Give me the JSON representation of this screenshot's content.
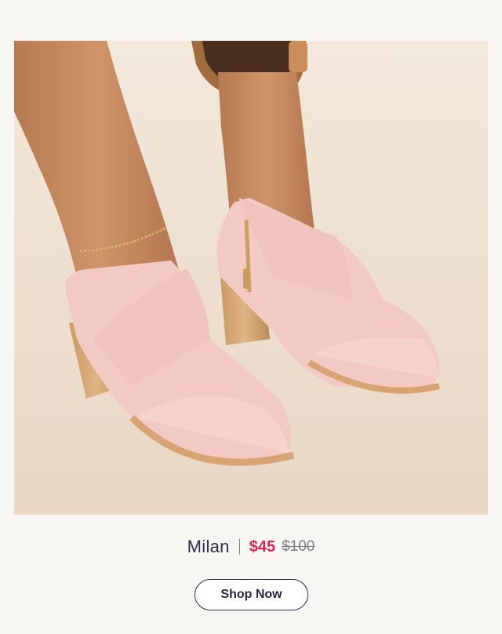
{
  "product": {
    "name": "Milan",
    "sale_price": "$45",
    "original_price": "$100"
  },
  "cta": {
    "label": "Shop Now"
  },
  "colors": {
    "background": "#f8f6f2",
    "sale_price": "#d7264f",
    "text": "#2c3048",
    "shoe": "#f2c9c3"
  }
}
